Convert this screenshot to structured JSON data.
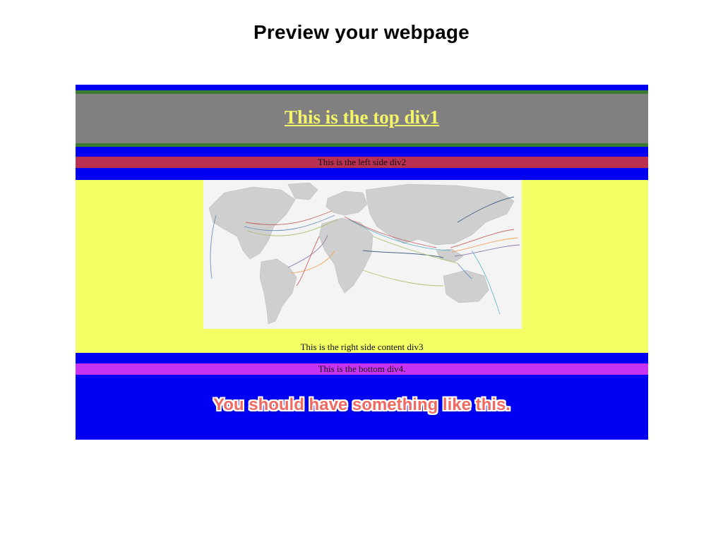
{
  "slide": {
    "title": "Preview your webpage"
  },
  "preview": {
    "top_div_text": "This is the top div1",
    "left_div_text": "This is the left side div2",
    "right_div_text": "This is the right side content div3",
    "bottom_div_text": "This is the bottom div4.",
    "caption": "You should have something like this.",
    "image_icon": "world-map-submarine-cables",
    "colors": {
      "frame_background": "#0000f5",
      "top_div_background": "#808080",
      "top_div_border": "#3a7a30",
      "top_div_link": "#f5f56a",
      "left_div_background": "#b93050",
      "right_div_background": "#f2fe64",
      "bottom_div_background": "#c733f0",
      "caption_text": "#f06a64"
    }
  }
}
